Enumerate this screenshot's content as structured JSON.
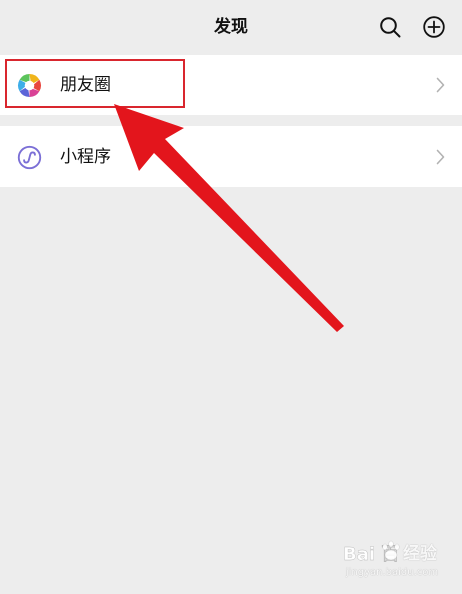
{
  "nav": {
    "title": "发现",
    "search_icon": "search-icon",
    "add_icon": "add-circle-icon"
  },
  "list": {
    "items": [
      {
        "label": "朋友圈",
        "icon": "moments-aperture-icon"
      },
      {
        "label": "小程序",
        "icon": "mini-program-icon"
      }
    ]
  },
  "annotation": {
    "highlight_color": "#d9262e",
    "arrow_color": "#e3151c"
  },
  "watermark": {
    "logo_text": "Bai 百",
    "name": "经验",
    "domain": "jingyan.baidu.com"
  },
  "colors": {
    "page_background": "#ededed",
    "cell_background": "#ffffff",
    "mini_program_icon": "#7b6fd6",
    "chevron": "#b2b2b2"
  }
}
